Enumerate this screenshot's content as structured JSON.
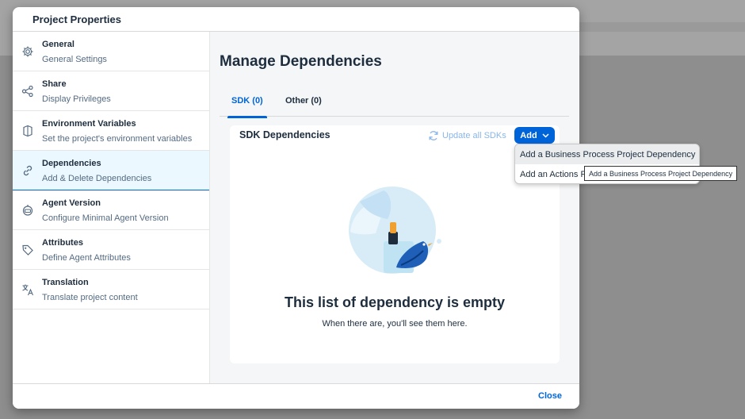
{
  "dialog": {
    "title": "Project Properties"
  },
  "sidebar": {
    "items": [
      {
        "title": "General",
        "subtitle": "General Settings",
        "icon": "gear-icon"
      },
      {
        "title": "Share",
        "subtitle": "Display Privileges",
        "icon": "share-icon"
      },
      {
        "title": "Environment Variables",
        "subtitle": "Set the project's environment variables",
        "icon": "cube-icon"
      },
      {
        "title": "Dependencies",
        "subtitle": "Add & Delete Dependencies",
        "icon": "link-icon",
        "active": true
      },
      {
        "title": "Agent Version",
        "subtitle": "Configure Minimal Agent Version",
        "icon": "robot-icon"
      },
      {
        "title": "Attributes",
        "subtitle": "Define Agent Attributes",
        "icon": "tag-icon"
      },
      {
        "title": "Translation",
        "subtitle": "Translate project content",
        "icon": "translate-icon"
      }
    ]
  },
  "main": {
    "heading": "Manage Dependencies",
    "tabs": [
      {
        "label": "SDK (0)",
        "selected": true
      },
      {
        "label": "Other (0)",
        "selected": false
      }
    ],
    "card": {
      "title": "SDK Dependencies",
      "update_label": "Update all SDKs",
      "add_label": "Add",
      "empty_title": "This list of dependency is empty",
      "empty_subtitle": "When there are, you'll see them here."
    }
  },
  "menu": {
    "items": [
      "Add a Business Process Project Dependency",
      "Add an Actions Project Dependency"
    ]
  },
  "tooltip": {
    "text": "Add a Business Process Project Dependency"
  },
  "footer": {
    "close_label": "Close"
  },
  "colors": {
    "accent": "#0064d9",
    "active_bg": "#ebf8ff",
    "panel_bg": "#f5f6f7"
  }
}
